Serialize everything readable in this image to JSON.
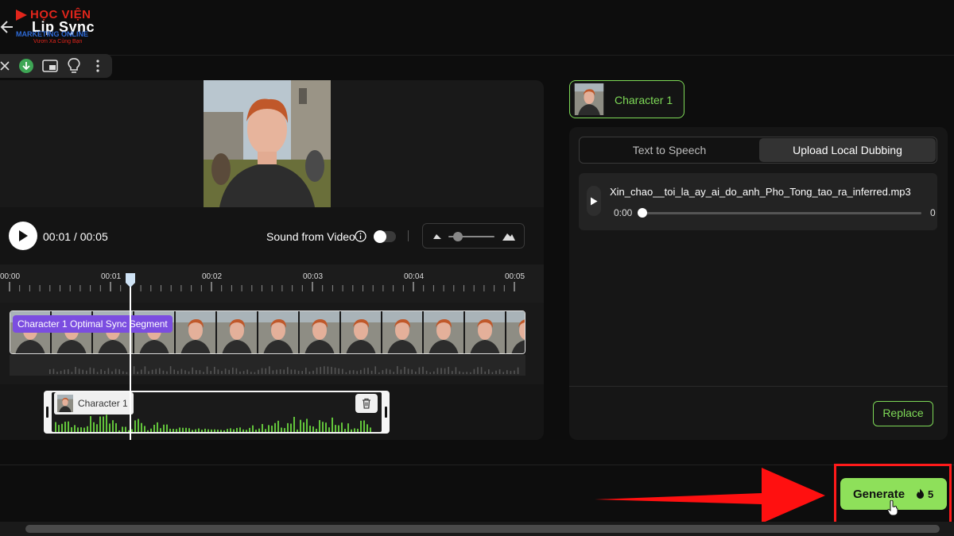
{
  "header": {
    "back_icon": "arrow-left-icon",
    "title": "Lip Sync"
  },
  "watermark": {
    "brand": "HỌC VIỆN",
    "sub": "MARKETING ONLINE",
    "tagline": "Vươn Xa Cùng Bạn"
  },
  "toolbar": {
    "icons": [
      "close-icon",
      "download-icon",
      "picture-in-picture-icon",
      "lightbulb-icon",
      "more-vertical-icon"
    ]
  },
  "player": {
    "time": "00:01 / 00:05",
    "sound_label": "Sound from Video",
    "sound_on": false,
    "volume": 0.2
  },
  "timeline": {
    "ticks": [
      "00:00",
      "00:01",
      "00:02",
      "00:03",
      "00:04",
      "00:05"
    ],
    "segment_badge": "Character 1 Optimal Sync Segment",
    "audio_clip_label": "Character 1"
  },
  "right_panel": {
    "character_tab": "Character 1",
    "tabs": [
      "Text to Speech",
      "Upload Local Dubbing"
    ],
    "active_tab": "Upload Local Dubbing",
    "audio": {
      "file_name": "Xin_chao__toi_la_ay_ai_do_anh_Pho_Tong_tao_ra_inferred.mp3",
      "current": "0:00",
      "end": "0"
    },
    "replace_label": "Replace"
  },
  "generate": {
    "label": "Generate",
    "cost": "5"
  },
  "colors": {
    "accent": "#7ed957",
    "generate_bg": "#8ee05a",
    "badge": "#7b4de0",
    "highlight": "#ff1a1a"
  }
}
